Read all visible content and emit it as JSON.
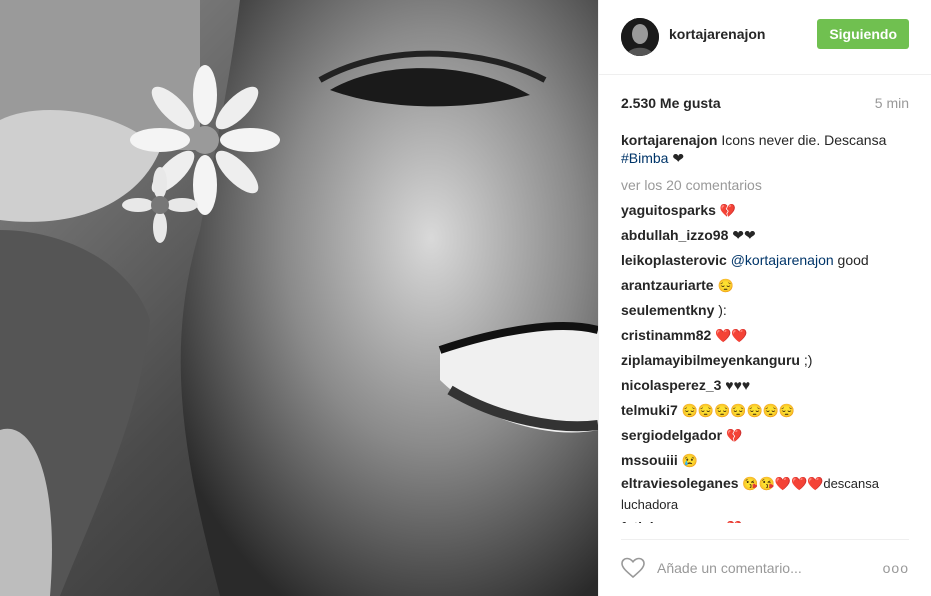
{
  "post": {
    "username": "kortajarenajon",
    "follow_label": "Siguiendo",
    "likes": "2.530 Me gusta",
    "time": "5 min",
    "caption_text": "Icons never die. Descansa",
    "caption_tag": "#Bimba",
    "caption_heart": "❤",
    "view_all": "ver los 20 comentarios"
  },
  "comments": [
    {
      "user": "yaguitosparks",
      "text": "💔"
    },
    {
      "user": "abdullah_izzo98",
      "text": "❤❤"
    },
    {
      "user": "leikoplasterovic",
      "mention": "@kortajarenajon",
      "text": "good"
    },
    {
      "user": "arantzauriarte",
      "text": "😔"
    },
    {
      "user": "seulementkny",
      "text": "):"
    },
    {
      "user": "cristinamm82",
      "text": "❤️❤️"
    },
    {
      "user": "ziplamayibilmeyenkanguru",
      "text": ";)"
    },
    {
      "user": "nicolasperez_3",
      "text": "♥♥♥"
    },
    {
      "user": "telmuki7",
      "text": "😔😔😔😔😔😔😔"
    },
    {
      "user": "sergiodelgador",
      "text": "💔"
    },
    {
      "user": "mssouiii",
      "text": "😢"
    },
    {
      "user": "eltraviesoleganes",
      "text": "😘😘❤️❤️❤️descansa luchadora"
    },
    {
      "user": "fetichesuances",
      "text": "💔"
    }
  ],
  "footer": {
    "placeholder": "Añade un comentario...",
    "more": "ooo"
  },
  "colors": {
    "follow_bg": "#70c050",
    "tag": "#003569"
  }
}
